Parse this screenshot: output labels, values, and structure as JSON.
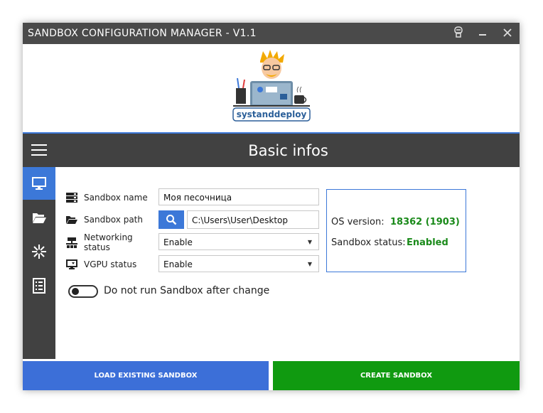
{
  "window": {
    "title": "SANDBOX CONFIGURATION MANAGER - V1.1"
  },
  "titlebar_icons": [
    "user-icon",
    "minimize-icon",
    "close-icon"
  ],
  "logo": {
    "text": "systanddeploy"
  },
  "section": {
    "title": "Basic infos"
  },
  "sidebar": {
    "items": [
      {
        "icon": "monitor-icon",
        "active": true
      },
      {
        "icon": "folder-open-icon",
        "active": false
      },
      {
        "icon": "star-burst-icon",
        "active": false
      },
      {
        "icon": "list-icon",
        "active": false
      }
    ]
  },
  "form": {
    "sandbox_name": {
      "label": "Sandbox name",
      "value": "Моя песочница"
    },
    "sandbox_path": {
      "label": "Sandbox path",
      "value": "C:\\Users\\User\\Desktop"
    },
    "networking": {
      "label": "Networking status",
      "value": "Enable"
    },
    "vgpu": {
      "label": "VGPU status",
      "value": "Enable"
    }
  },
  "info": {
    "os_version_label": "OS version:",
    "os_version_value": "18362 (1903)",
    "sandbox_status_label": "Sandbox status:",
    "sandbox_status_value": "Enabled"
  },
  "toggle": {
    "label": "Do not run Sandbox after change",
    "checked": false
  },
  "buttons": {
    "load": "LOAD EXISTING SANDBOX",
    "create": "CREATE SANDBOX"
  },
  "colors": {
    "accent": "#3c78d8",
    "success": "#109a10",
    "dark": "#414141"
  }
}
